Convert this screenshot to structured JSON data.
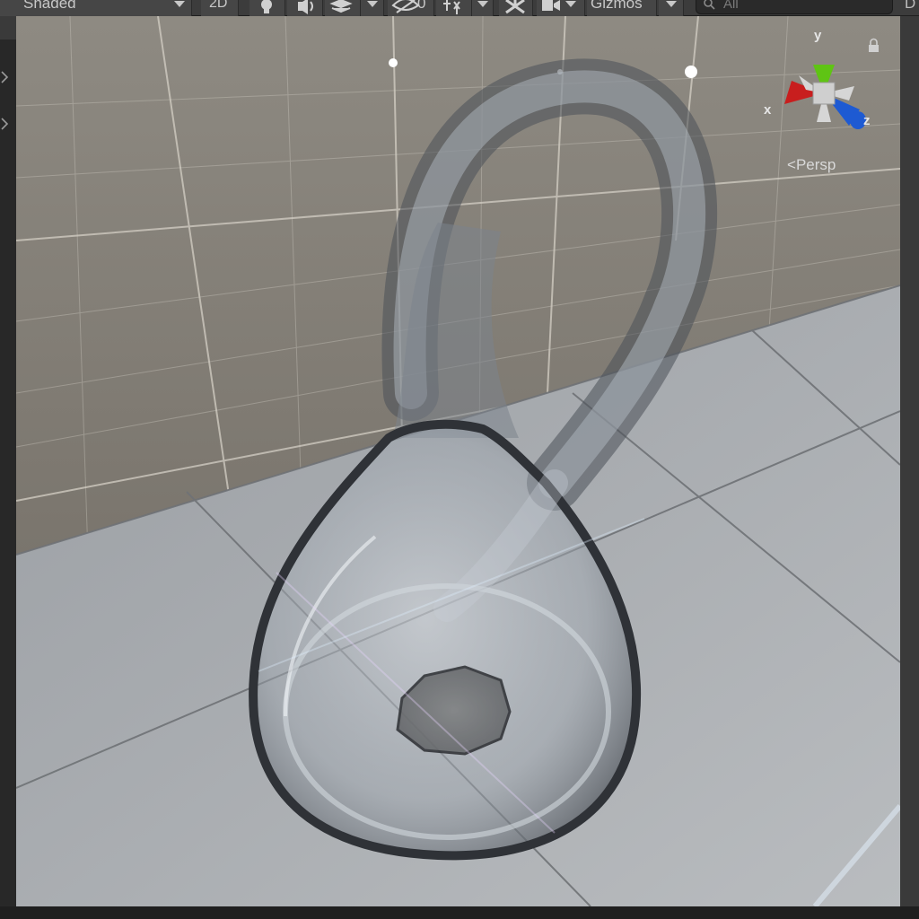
{
  "toolbar": {
    "shading_mode": "Shaded",
    "view_2d_label": "2D",
    "hidden_count": "0",
    "gizmos_label": "Gizmos",
    "search_placeholder": "All"
  },
  "right_panel": {
    "partial_label": "D"
  },
  "gizmo": {
    "axis_y": "y",
    "axis_x": "x",
    "axis_z": "z",
    "projection_label": "Persp",
    "colors": {
      "y": "#5fc414",
      "x": "#c81e1e",
      "z": "#1e5ad2",
      "center": "#cfcfcf"
    }
  },
  "icons": [
    "light-bulb-icon",
    "audio-icon",
    "effects-icon",
    "visibility-icon",
    "tool-handle-icon",
    "grid-snap-icon",
    "camera-icon",
    "lock-icon",
    "search-icon",
    "expand-arrow-icon"
  ],
  "scene": {
    "object": "klein-bottle",
    "background": "tiled-room"
  }
}
